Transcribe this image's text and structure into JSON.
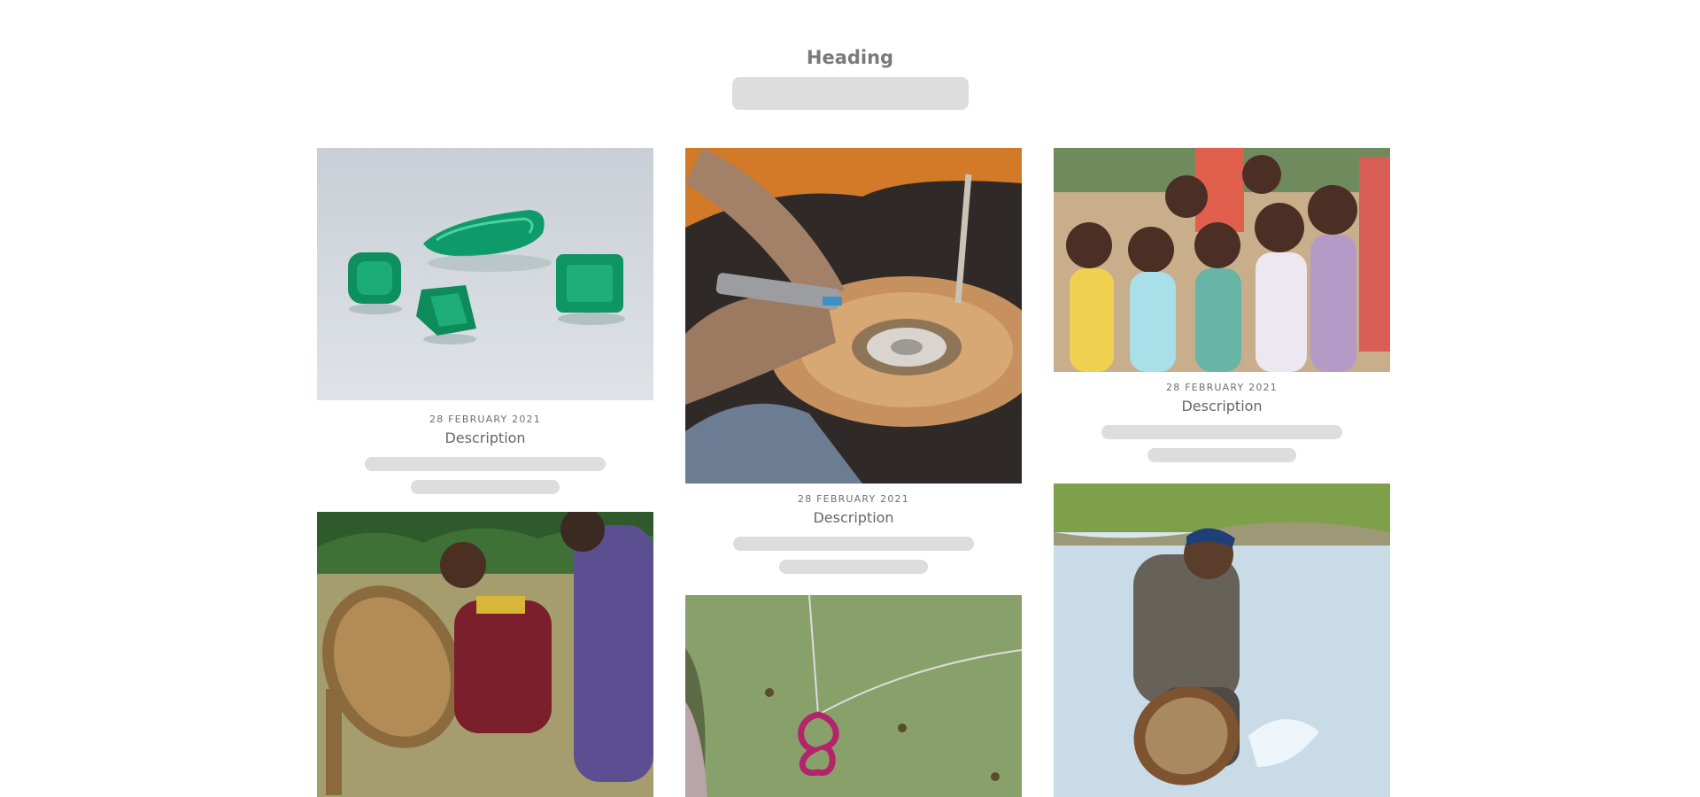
{
  "header": {
    "title": "Heading"
  },
  "cards": [
    {
      "date": "28 FEBRUARY 2021",
      "description": "Description",
      "image": "green-gemstones-photo"
    },
    {
      "date": "28 FEBRUARY 2021",
      "description": "Description",
      "image": "gem-cutting-wheel-photo"
    },
    {
      "date": "28 FEBRUARY 2021",
      "description": "Description",
      "image": "smiling-children-photo"
    },
    {
      "image": "river-gem-sieving-photo"
    },
    {
      "image": "ruby-pendant-on-cactus-photo"
    },
    {
      "image": "man-washing-gravel-basket-photo"
    }
  ],
  "colors": {
    "placeholder": "#dddddd",
    "heading_text": "#7a7a7a",
    "date_text": "#707070",
    "description_text": "#666666"
  }
}
